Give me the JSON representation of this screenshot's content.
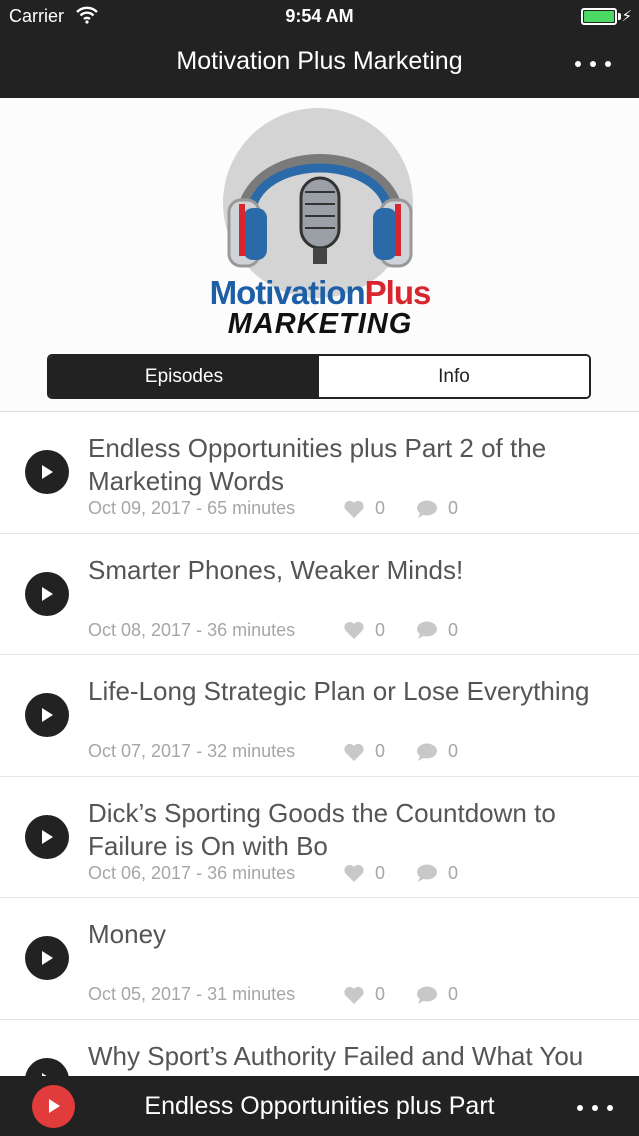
{
  "status_bar": {
    "carrier": "Carrier",
    "time": "9:54 AM"
  },
  "nav": {
    "title": "Motivation Plus Marketing",
    "more_icon": "ellipsis-icon"
  },
  "logo": {
    "word_part1": "Motivation",
    "word_part2": "Plus",
    "subtitle": "MARKETING"
  },
  "tabs": [
    {
      "label": "Episodes",
      "selected": true
    },
    {
      "label": "Info",
      "selected": false
    }
  ],
  "episodes": [
    {
      "title": "Endless Opportunities plus Part 2 of the Marketing Words",
      "meta": "Oct 09, 2017 - 65 minutes",
      "likes": "0",
      "comments": "0"
    },
    {
      "title": "Smarter Phones, Weaker Minds!",
      "meta": "Oct 08, 2017 - 36 minutes",
      "likes": "0",
      "comments": "0"
    },
    {
      "title": "Life-Long Strategic Plan or Lose Everything",
      "meta": "Oct 07, 2017 - 32 minutes",
      "likes": "0",
      "comments": "0"
    },
    {
      "title": "Dick’s Sporting Goods the Countdown to Failure is On with Bo",
      "meta": "Oct 06, 2017 - 36 minutes",
      "likes": "0",
      "comments": "0"
    },
    {
      "title": "Money",
      "meta": "Oct 05, 2017 - 31 minutes",
      "likes": "0",
      "comments": "0"
    },
    {
      "title": "Why Sport’s Authority Failed and What You",
      "meta": "",
      "likes": "",
      "comments": ""
    }
  ],
  "player": {
    "now_playing": "Endless Opportunities plus Part"
  },
  "colors": {
    "bar": "#222222",
    "accent_red": "#e23b3b",
    "logo_blue": "#1d5fa6",
    "logo_red": "#d8262e",
    "muted_text": "#a6a6a6"
  }
}
